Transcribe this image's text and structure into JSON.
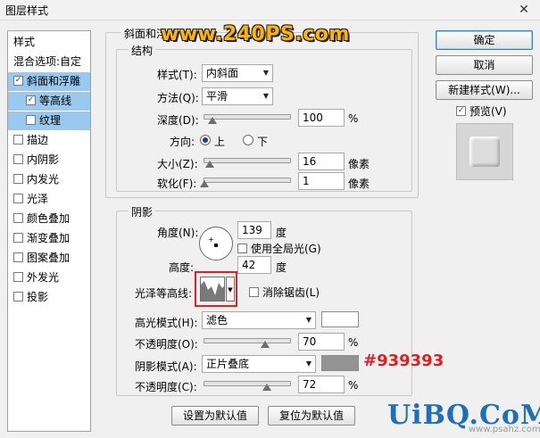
{
  "window": {
    "title": "图层样式",
    "close_glyph": "✕"
  },
  "watermark_top": "www.240PS.com",
  "left_panel": {
    "items": [
      {
        "label": "样式",
        "checkbox": false
      },
      {
        "label": "混合选项:自定",
        "checkbox": false
      },
      {
        "label": "斜面和浮雕",
        "checkbox": true,
        "checked": true,
        "selected": true
      },
      {
        "label": "等高线",
        "checkbox": true,
        "checked": true,
        "selected": true,
        "sub": true
      },
      {
        "label": "纹理",
        "checkbox": true,
        "checked": false,
        "selected": true,
        "sub": true
      },
      {
        "label": "描边",
        "checkbox": true,
        "checked": false
      },
      {
        "label": "内阴影",
        "checkbox": true,
        "checked": false
      },
      {
        "label": "内发光",
        "checkbox": true,
        "checked": false
      },
      {
        "label": "光泽",
        "checkbox": true,
        "checked": false
      },
      {
        "label": "颜色叠加",
        "checkbox": true,
        "checked": false
      },
      {
        "label": "渐变叠加",
        "checkbox": true,
        "checked": false
      },
      {
        "label": "图案叠加",
        "checkbox": true,
        "checked": false
      },
      {
        "label": "外发光",
        "checkbox": true,
        "checked": false
      },
      {
        "label": "投影",
        "checkbox": true,
        "checked": false
      }
    ]
  },
  "bevel": {
    "group_title": "斜面和浮雕",
    "structure_title": "结构",
    "style_label": "样式(T):",
    "style_value": "内斜面",
    "technique_label": "方法(Q):",
    "technique_value": "平滑",
    "depth_label": "深度(D):",
    "depth_value": "100",
    "depth_slider": 0.1,
    "percent": "%",
    "direction_label": "方向:",
    "direction_up": "上",
    "direction_down": "下",
    "size_label": "大小(Z):",
    "size_value": "16",
    "size_slider": 0.07,
    "size_unit": "像素",
    "soften_label": "软化(F):",
    "soften_value": "1",
    "soften_slider": 0.01,
    "soften_unit": "像素"
  },
  "shading": {
    "title": "阴影",
    "angle_label": "角度(N):",
    "angle_value": "139",
    "angle_unit": "度",
    "global_light_label": "使用全局光(G)",
    "altitude_label": "高度:",
    "altitude_value": "42",
    "altitude_unit": "度",
    "gloss_contour_label": "光泽等高线:",
    "anti_alias_label": "消除锯齿(L)",
    "highlight_mode_label": "高光模式(H):",
    "highlight_mode_value": "滤色",
    "highlight_color": "#ffffff",
    "highlight_opacity_label": "不透明度(O):",
    "highlight_opacity_value": "70",
    "highlight_opacity_slider": 0.7,
    "shadow_mode_label": "阴影模式(A):",
    "shadow_mode_value": "正片叠底",
    "shadow_color": "#939393",
    "shadow_color_note": "#939393",
    "shadow_opacity_label": "不透明度(C):",
    "shadow_opacity_value": "72",
    "shadow_opacity_slider": 0.72
  },
  "footer": {
    "make_default": "设置为默认值",
    "reset_default": "复位为默认值"
  },
  "right": {
    "ok": "确定",
    "cancel": "取消",
    "new_style": "新建样式(W)...",
    "preview_label": "预览(V)"
  },
  "brand_bottom": "UiBQ.CoM",
  "brand_url": "www.psahz.com"
}
